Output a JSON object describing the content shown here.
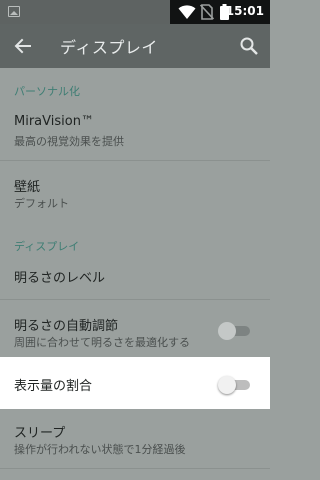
{
  "status_bar": {
    "time": "15:01",
    "icons": [
      "image-notification-icon",
      "wifi-icon",
      "no-sim-icon",
      "battery-icon"
    ]
  },
  "toolbar": {
    "title": "ディスプレイ",
    "back_icon": "arrow-left-icon",
    "search_icon": "search-icon"
  },
  "sections": [
    {
      "header": "パーソナル化",
      "items": [
        {
          "title": "MiraVision™",
          "summary": "最高の視覚効果を提供"
        },
        {
          "title": "壁紙",
          "summary": "デフォルト"
        }
      ]
    },
    {
      "header": "ディスプレイ",
      "items": [
        {
          "title": "明るさのレベル",
          "summary": ""
        },
        {
          "title": "明るさの自動調節",
          "summary": "周囲に合わせて明るさを最適化する",
          "toggle": false
        },
        {
          "title": "表示量の割合",
          "summary": "",
          "toggle": false
        },
        {
          "title": "スリープ",
          "summary": "操作が行われない状態で1分経過後"
        }
      ]
    }
  ],
  "colors": {
    "status_bar": "#5e6362",
    "toolbar": "#5f6564",
    "background_dimmed": "#9aa09e",
    "category_text": "#3f7e74",
    "highlight": "#ffffff"
  }
}
